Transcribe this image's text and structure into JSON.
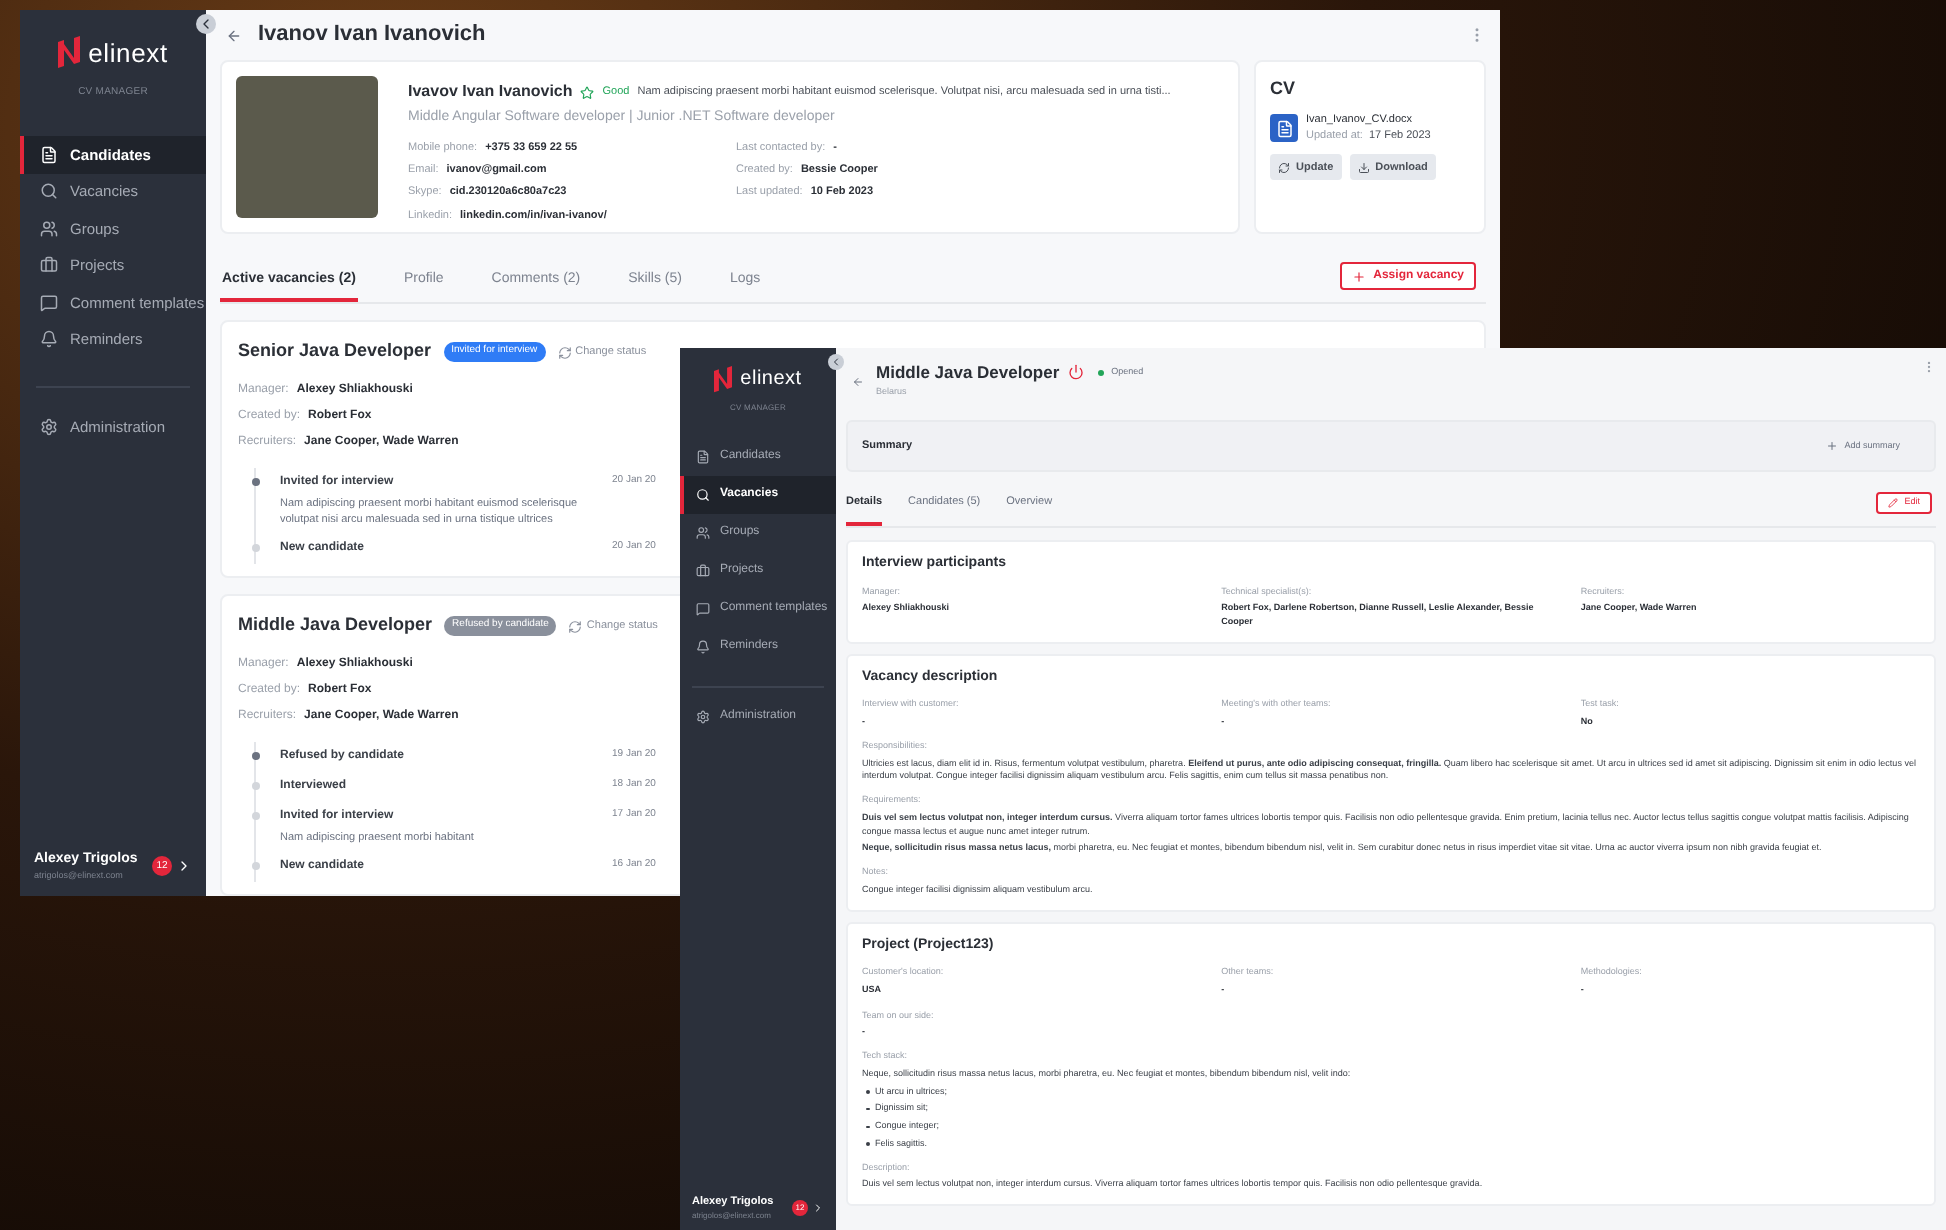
{
  "back_window": {
    "sidebar": {
      "logo": "elinext",
      "subtitle": "CV MANAGER",
      "nav": [
        {
          "label": "Candidates",
          "selected": true
        },
        {
          "label": "Vacancies",
          "selected": false
        },
        {
          "label": "Groups",
          "selected": false
        },
        {
          "label": "Projects",
          "selected": false
        },
        {
          "label": "Comment templates",
          "selected": false
        },
        {
          "label": "Reminders",
          "selected": false
        }
      ],
      "admin": "Administration",
      "user": {
        "name": "Alexey Trigolos",
        "email": "atrigolos@elinext.com",
        "badge": "12"
      }
    },
    "header": {
      "title": "Ivanov Ivan Ivanovich"
    },
    "profile": {
      "name": "Ivavov Ivan Ivanovich",
      "rating": "Good",
      "note": "Nam adipiscing praesent morbi habitant euismod scelerisque. Volutpat nisi, arcu malesuada sed in urna tisti...",
      "subtitle": "Middle Angular Software developer | Junior .NET Software developer",
      "fields_left": [
        {
          "label": "Mobile phone:",
          "value": "+375 33 659 22 55"
        },
        {
          "label": "Email:",
          "value": "ivanov@gmail.com"
        },
        {
          "label": "Skype:",
          "value": "cid.230120a6c80a7c23"
        },
        {
          "label": "Linkedin:",
          "value": "linkedin.com/in/ivan-ivanov/"
        }
      ],
      "fields_right": [
        {
          "label": "Last contacted by:",
          "value": "-"
        },
        {
          "label": "Created by:",
          "value": "Bessie Cooper"
        },
        {
          "label": "Last updated:",
          "value": "10 Feb 2023"
        }
      ]
    },
    "cv": {
      "title": "CV",
      "file": "Ivan_Ivanov_CV.docx",
      "updated_label": "Updated at:",
      "updated": "17 Feb 2023",
      "buttons": [
        "Update",
        "Download"
      ]
    },
    "tabs": [
      {
        "label": "Active vacancies (2)",
        "selected": true
      },
      {
        "label": "Profile",
        "selected": false
      },
      {
        "label": "Comments (2)",
        "selected": false
      },
      {
        "label": "Skills (5)",
        "selected": false
      },
      {
        "label": "Logs",
        "selected": false
      }
    ],
    "assign_button": "Assign vacancy",
    "vacancies": [
      {
        "title": "Senior Java Developer",
        "status": "Invited for interview",
        "color": "#2f7cf6",
        "change_status": "Change status",
        "fields": [
          {
            "label": "Manager:",
            "value": "Alexey Shliakhouski"
          },
          {
            "label": "Created by:",
            "value": "Robert Fox"
          },
          {
            "label": "Recruiters:",
            "value": "Jane Cooper, Wade Warren"
          }
        ],
        "timeline": [
          {
            "title": "Invited for interview",
            "text": "Nam adipiscing praesent morbi habitant euismod scelerisque volutpat nisi arcu malesuada sed in urna tistique ultrices",
            "date": "20 Jan 20",
            "current": true
          },
          {
            "title": "New candidate",
            "date": "20 Jan 20",
            "current": false
          }
        ]
      },
      {
        "title": "Middle Java Developer",
        "status": "Refused by candidate",
        "color": "#8a909c",
        "change_status": "Change status",
        "fields": [
          {
            "label": "Manager:",
            "value": "Alexey Shliakhouski"
          },
          {
            "label": "Created by:",
            "value": "Robert Fox"
          },
          {
            "label": "Recruiters:",
            "value": "Jane Cooper, Wade Warren"
          }
        ],
        "timeline": [
          {
            "title": "Refused by candidate",
            "date": "19 Jan 20",
            "current": true
          },
          {
            "title": "Interviewed",
            "date": "18 Jan 20",
            "current": false
          },
          {
            "title": "Invited for interview",
            "text": "Nam adipiscing praesent morbi habitant",
            "date": "17 Jan 20",
            "current": false
          },
          {
            "title": "New candidate",
            "date": "16 Jan 20",
            "current": false
          }
        ]
      }
    ]
  },
  "front_window": {
    "sidebar": {
      "logo": "elinext",
      "subtitle": "CV MANAGER",
      "nav": [
        {
          "label": "Candidates",
          "selected": false
        },
        {
          "label": "Vacancies",
          "selected": true
        },
        {
          "label": "Groups",
          "selected": false
        },
        {
          "label": "Projects",
          "selected": false
        },
        {
          "label": "Comment templates",
          "selected": false
        },
        {
          "label": "Reminders",
          "selected": false
        }
      ],
      "admin": "Administration",
      "user": {
        "name": "Alexey Trigolos",
        "email": "atrigolos@elinext.com",
        "badge": "12"
      }
    },
    "header": {
      "title": "Middle Java Developer",
      "status": "Opened",
      "location": "Belarus"
    },
    "summary": {
      "title": "Summary",
      "action": "Add summary"
    },
    "tabs": [
      {
        "label": "Details",
        "selected": true
      },
      {
        "label": "Candidates (5)",
        "selected": false
      },
      {
        "label": "Overview",
        "selected": false
      }
    ],
    "edit_button": "Edit",
    "interview": {
      "title": "Interview participants",
      "fields": [
        {
          "label": "Manager:",
          "value": "Alexey Shliakhouski"
        },
        {
          "label": "Technical specialist(s):",
          "value": "Robert Fox, Darlene Robertson, Dianne Russell, Leslie Alexander, Bessie Cooper"
        },
        {
          "label": "Recruiters:",
          "value": "Jane Cooper, Wade Warren"
        }
      ]
    },
    "description": {
      "title": "Vacancy description",
      "fields": [
        {
          "label": "Interview with customer:",
          "value": "-"
        },
        {
          "label": "Meeting's with other teams:",
          "value": "-"
        },
        {
          "label": "Test task:",
          "value": "No"
        }
      ],
      "blocks": [
        {
          "label": "Responsibilities:",
          "paragraphs": [
            "Ultricies est lacus, diam elit id in. Risus, fermentum volutpat vestibulum, pharetra. **Eleifend ut purus, ante odio adipiscing consequat, fringilla.** Quam libero hac scelerisque sit amet. Ut arcu in ultrices sed id amet sit adipiscing. Dignissim sit enim in odio lectus vel interdum volutpat. Congue integer facilisi dignissim aliquam vestibulum arcu. Felis sagittis, enim cum tellus sit massa penatibus non."
          ]
        },
        {
          "label": "Requirements:",
          "paragraphs": [
            "**Duis vel sem lectus volutpat non, integer interdum cursus.** Viverra aliquam tortor fames ultrices lobortis tempor quis. Facilisis non odio pellentesque gravida. Enim pretium, lacinia tellus nec. Auctor lectus tellus sagittis congue volutpat mattis facilisis. Adipiscing congue massa lectus et augue nunc amet integer rutrum.",
            "**Neque, sollicitudin risus massa netus lacus,** morbi pharetra, eu. Nec feugiat et montes, bibendum bibendum nisl, velit in. Sem curabitur donec netus in risus imperdiet vitae sit vitae. Urna ac auctor viverra ipsum non nibh gravida feugiat et."
          ]
        },
        {
          "label": "Notes:",
          "paragraphs": [
            "Congue integer facilisi dignissim aliquam vestibulum arcu."
          ]
        }
      ]
    },
    "project": {
      "title": "Project (Project123)",
      "fields": [
        {
          "label": "Customer's location:",
          "value": "USA"
        },
        {
          "label": "Other teams:",
          "value": "-"
        },
        {
          "label": "Methodologies:",
          "value": "-"
        },
        {
          "label": "Team on our side:",
          "value": "-"
        }
      ],
      "tech_label": "Tech stack:",
      "tech_intro": "Neque, sollicitudin risus massa netus lacus, morbi pharetra, eu. Nec feugiat et montes, bibendum bibendum nisl, velit indo:",
      "tech_items": [
        "Ut arcu in ultrices;",
        "Dignissim sit;",
        "Congue integer;",
        "Felis sagittis."
      ],
      "description_label": "Description:",
      "description": "Duis vel sem lectus volutpat non, integer interdum cursus. Viverra aliquam tortor fames ultrices lobortis tempor quis. Facilisis non odio pellentesque gravida."
    }
  }
}
